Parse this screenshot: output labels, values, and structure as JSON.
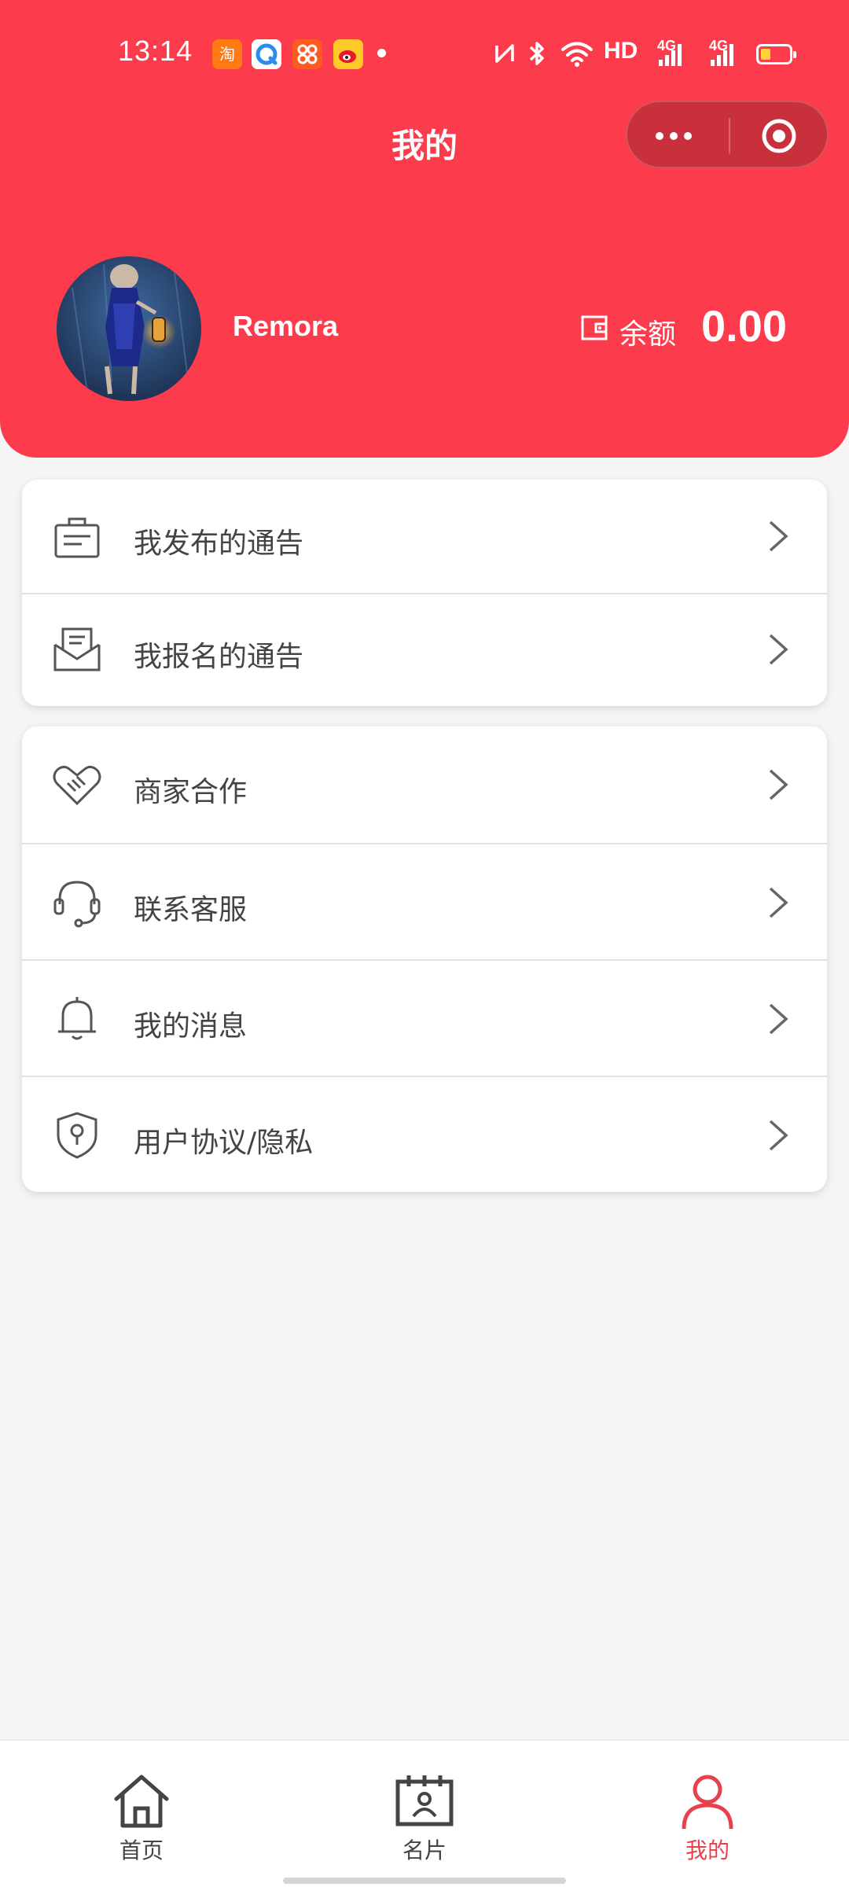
{
  "status_bar": {
    "time": "13:14",
    "network_label": "HD",
    "signal_label_1": "4G",
    "signal_label_2": "4G",
    "app_icons": [
      "taobao-icon",
      "browser-icon",
      "app-grid-icon",
      "weibo-icon"
    ],
    "system_icons": [
      "nfc-icon",
      "bluetooth-icon",
      "wifi-icon",
      "signal-icon",
      "battery-icon"
    ],
    "battery_level": 0.35
  },
  "nav": {
    "title": "我的",
    "more_icon": "more-icon",
    "close_icon": "target-icon"
  },
  "profile": {
    "username": "Remora",
    "balance_label": "余额",
    "balance_value": "0.00",
    "balance_icon": "wallet-icon"
  },
  "menu_groups": [
    {
      "items": [
        {
          "label": "我发布的通告",
          "icon": "briefcase-icon"
        },
        {
          "label": "我报名的通告",
          "icon": "envelope-icon"
        }
      ]
    },
    {
      "items": [
        {
          "label": "商家合作",
          "icon": "handshake-icon"
        },
        {
          "label": "联系客服",
          "icon": "headset-icon"
        },
        {
          "label": "我的消息",
          "icon": "bell-icon"
        },
        {
          "label": "用户协议/隐私",
          "icon": "shield-icon"
        }
      ]
    }
  ],
  "tabbar": {
    "tabs": [
      {
        "label": "首页",
        "icon": "home-icon"
      },
      {
        "label": "名片",
        "icon": "card-icon"
      },
      {
        "label": "我的",
        "icon": "user-icon"
      }
    ],
    "active_tab": "我的"
  },
  "colors": {
    "brand_red": "#fc3c4c",
    "active_tab": "#e8414d",
    "page_background": "#f5f5f5"
  }
}
